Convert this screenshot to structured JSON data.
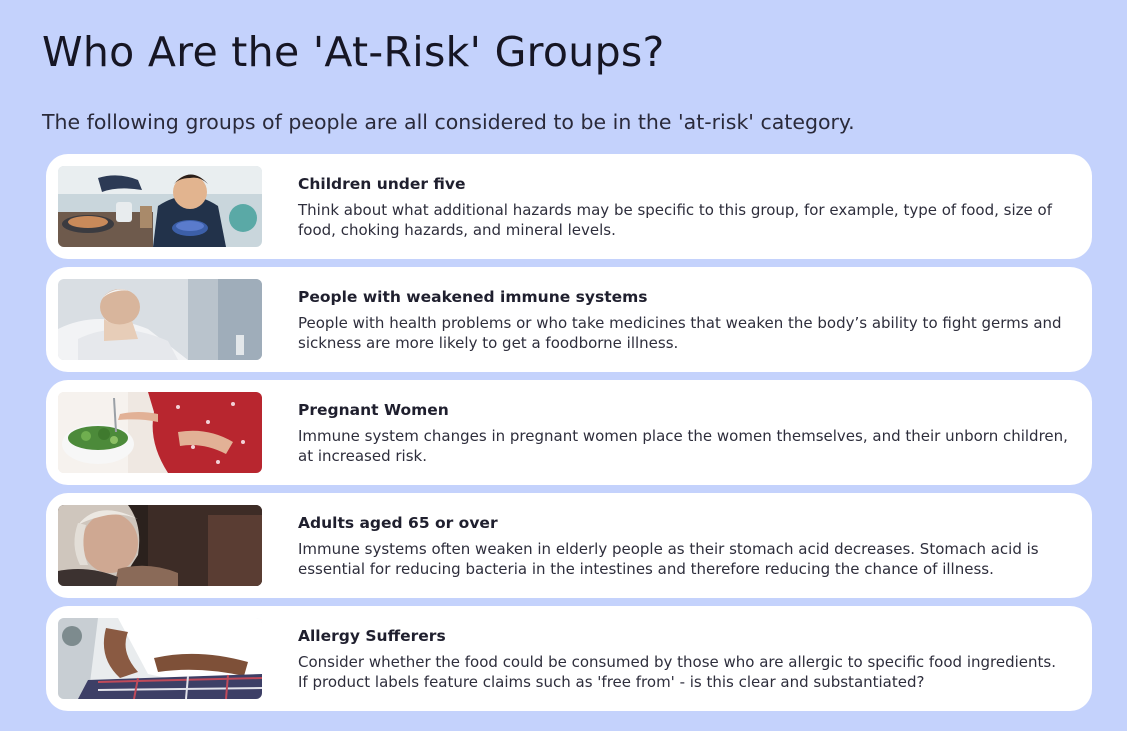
{
  "page": {
    "title": "Who Are the 'At-Risk' Groups?",
    "intro": "The following groups of people are all considered to be in the 'at-risk' category."
  },
  "groups": [
    {
      "heading": "Children under five",
      "body": "Think about what additional hazards may be specific to this group, for example, type of food, size of food, choking hazards, and mineral levels.",
      "image": "child-eating-photo"
    },
    {
      "heading": "People with weakened immune systems",
      "body": "People with health problems or who take medicines that weaken the body’s ability to fight germs and sickness are more likely to get a foodborne illness.",
      "image": "elderly-man-in-hospital-bed-photo"
    },
    {
      "heading": "Pregnant Women",
      "body": "Immune system changes in pregnant women place the women themselves, and their unborn children, at increased risk.",
      "image": "pregnant-woman-with-salad-photo"
    },
    {
      "heading": "Adults aged 65 or over",
      "body": "Immune systems often weaken in elderly people as their stomach acid decreases. Stomach acid is essential for reducing bacteria in the intestines and therefore reducing the chance of illness.",
      "image": "elderly-woman-portrait-photo"
    },
    {
      "heading": "Allergy Sufferers",
      "body": "Consider whether the food could be consumed by those who are allergic to specific food ingredients. If product labels feature claims such as 'free from' - is this clear and substantiated?",
      "image": "person-with-stomach-ache-photo"
    }
  ],
  "colors": {
    "background": "#c4d2fc",
    "card": "#ffffff",
    "text": "#1f1f2e"
  }
}
